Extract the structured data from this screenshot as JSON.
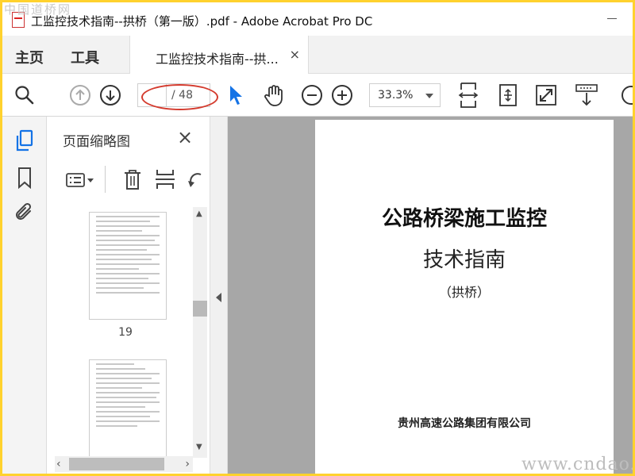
{
  "window": {
    "title": "工监控技术指南--拱桥（第一版）.pdf - Adobe Acrobat Pro DC",
    "watermark_top": "中国道桥网",
    "watermark_bottom": "www.cndao.cc"
  },
  "tabs": {
    "home": "主页",
    "tools": "工具",
    "document": "工监控技术指南--拱...",
    "close": "×"
  },
  "toolbar": {
    "current_page": "",
    "page_total": "/ 48",
    "zoom": "33.3%"
  },
  "panel": {
    "title": "页面缩略图",
    "close": "×",
    "thumbnails": [
      {
        "label": "19"
      },
      {
        "label": ""
      }
    ]
  },
  "document": {
    "title": "公路桥梁施工监控",
    "subtitle": "技术指南",
    "note": "（拱桥）",
    "organization": "贵州高速公路集团有限公司"
  },
  "colors": {
    "accent": "#1473e6",
    "annotation": "#d43b2e",
    "frame": "#ffd22e"
  }
}
